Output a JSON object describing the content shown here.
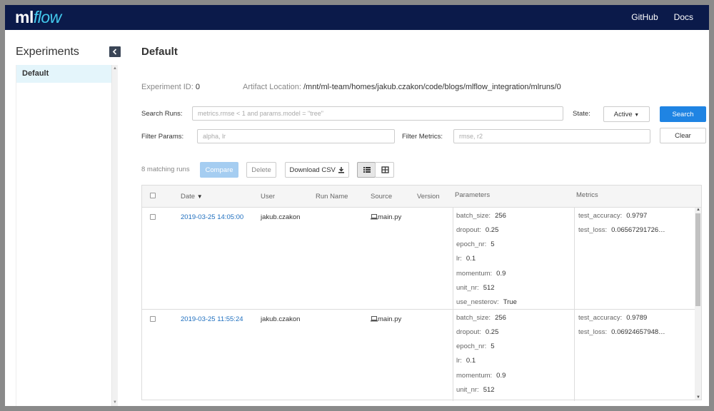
{
  "header": {
    "logo_ml": "ml",
    "logo_flow": "flow",
    "nav": [
      "GitHub",
      "Docs"
    ]
  },
  "sidebar": {
    "title": "Experiments",
    "items": [
      "Default"
    ]
  },
  "experiment": {
    "name": "Default",
    "id_label": "Experiment ID:",
    "id": "0",
    "artifact_label": "Artifact Location:",
    "artifact_location": "/mnt/ml-team/homes/jakub.czakon/code/blogs/mlflow_integration/mlruns/0"
  },
  "search": {
    "search_runs_label": "Search Runs:",
    "search_placeholder": "metrics.rmse < 1 and params.model = \"tree\"",
    "state_label": "State:",
    "state_value": "Active",
    "search_button": "Search",
    "filter_params_label": "Filter Params:",
    "filter_params_placeholder": "alpha, lr",
    "filter_metrics_label": "Filter Metrics:",
    "filter_metrics_placeholder": "rmse, r2",
    "clear_button": "Clear"
  },
  "toolbar": {
    "matching": "8 matching runs",
    "compare": "Compare",
    "delete": "Delete",
    "download": "Download CSV"
  },
  "table": {
    "headers": {
      "date": "Date",
      "user": "User",
      "run_name": "Run Name",
      "source": "Source",
      "version": "Version",
      "parameters": "Parameters",
      "metrics": "Metrics"
    },
    "rows": [
      {
        "date": "2019-03-25 14:05:00",
        "user": "jakub.czakon",
        "source": "main.py",
        "params": [
          {
            "k": "batch_size:",
            "v": "256"
          },
          {
            "k": "dropout:",
            "v": "0.25"
          },
          {
            "k": "epoch_nr:",
            "v": "5"
          },
          {
            "k": "lr:",
            "v": "0.1"
          },
          {
            "k": "momentum:",
            "v": "0.9"
          },
          {
            "k": "unit_nr:",
            "v": "512"
          },
          {
            "k": "use_nesterov:",
            "v": "True"
          }
        ],
        "metrics": [
          {
            "k": "test_accuracy:",
            "v": "0.9797"
          },
          {
            "k": "test_loss:",
            "v": "0.06567291726…"
          }
        ]
      },
      {
        "date": "2019-03-25 11:55:24",
        "user": "jakub.czakon",
        "source": "main.py",
        "params": [
          {
            "k": "batch_size:",
            "v": "256"
          },
          {
            "k": "dropout:",
            "v": "0.25"
          },
          {
            "k": "epoch_nr:",
            "v": "5"
          },
          {
            "k": "lr:",
            "v": "0.1"
          },
          {
            "k": "momentum:",
            "v": "0.9"
          },
          {
            "k": "unit_nr:",
            "v": "512"
          }
        ],
        "metrics": [
          {
            "k": "test_accuracy:",
            "v": "0.9789"
          },
          {
            "k": "test_loss:",
            "v": "0.06924657948…"
          }
        ]
      }
    ]
  }
}
